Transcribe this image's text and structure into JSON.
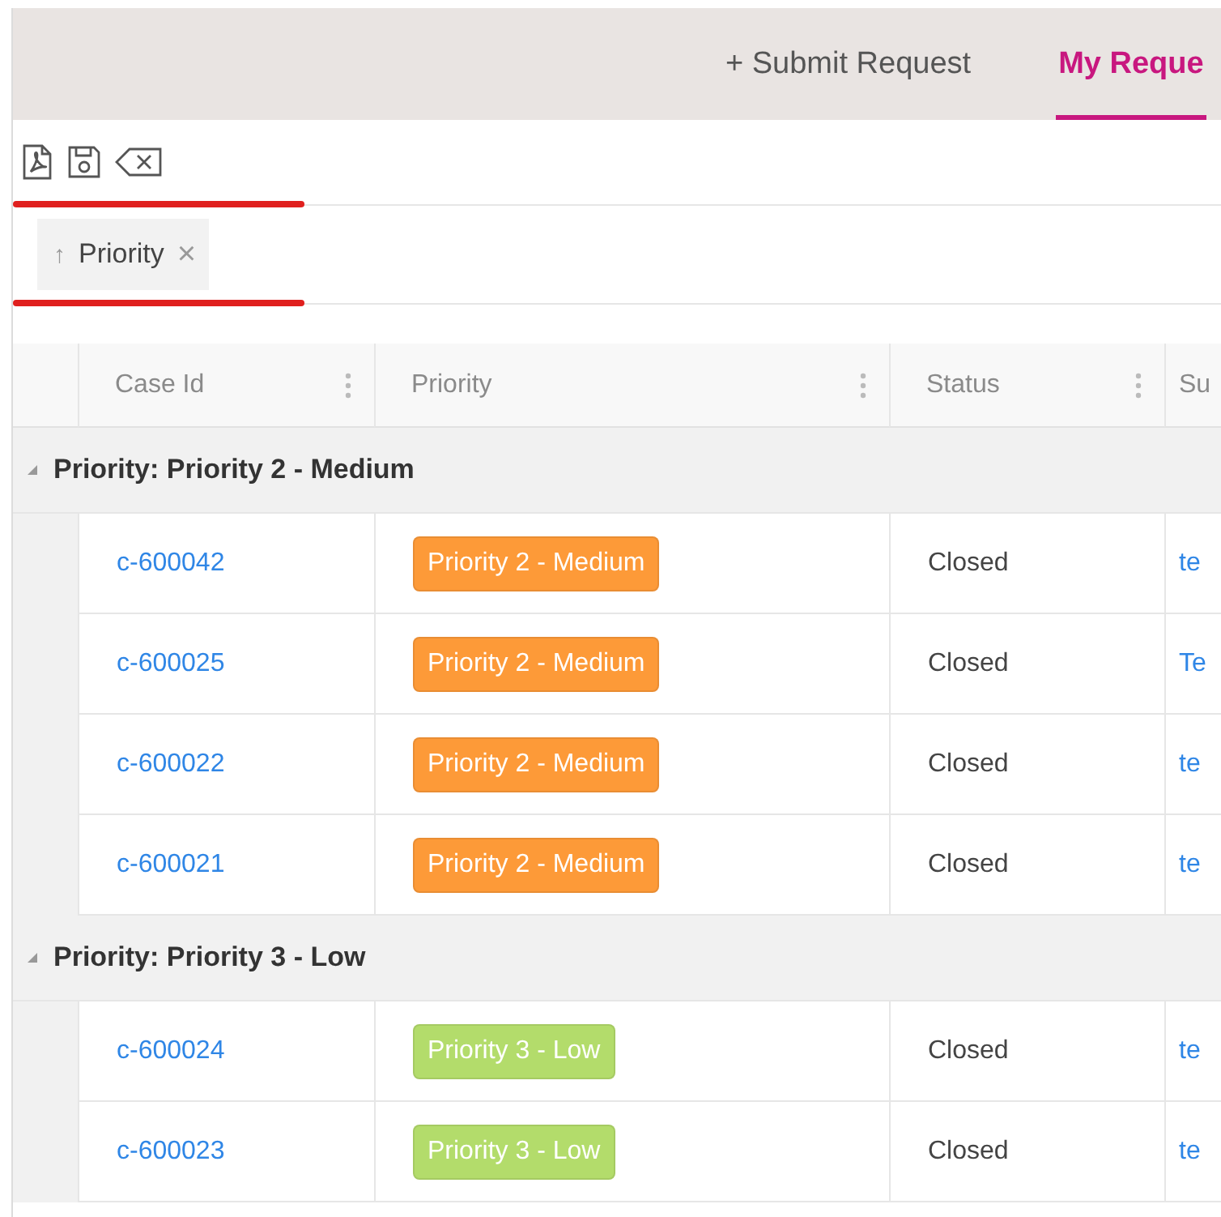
{
  "tabs": [
    {
      "label": "+ Submit Request",
      "selected": false
    },
    {
      "label": "My Reque",
      "selected": true
    }
  ],
  "sort_chips": [
    {
      "arrow": "↑",
      "label": "Priority",
      "remove": "×"
    }
  ],
  "table": {
    "columns": [
      {
        "label": "Case Id",
        "menu": true
      },
      {
        "label": "Priority",
        "menu": true
      },
      {
        "label": "Status",
        "menu": true
      },
      {
        "label": "Su"
      }
    ],
    "groups": [
      {
        "label": "Priority: Priority 2 - Medium",
        "expanded": true,
        "rows": [
          {
            "case_id": "c-600042",
            "priority": {
              "label": "Priority 2 - Medium",
              "color": "#fd9a38"
            },
            "status": "Closed",
            "column_4": "te"
          },
          {
            "case_id": "c-600025",
            "priority": {
              "label": "Priority 2 - Medium",
              "color": "#fd9a38"
            },
            "status": "Closed",
            "column_4": "Te"
          },
          {
            "case_id": "c-600022",
            "priority": {
              "label": "Priority 2 - Medium",
              "color": "#fd9a38"
            },
            "status": "Closed",
            "column_4": "te"
          },
          {
            "case_id": "c-600021",
            "priority": {
              "label": "Priority 2 - Medium",
              "color": "#fd9a38"
            },
            "status": "Closed",
            "column_4": "te"
          }
        ]
      },
      {
        "label": "Priority: Priority 3 - Low",
        "expanded": true,
        "rows": [
          {
            "case_id": "c-600024",
            "priority": {
              "label": "Priority 3 - Low",
              "color": "#b3dc6b"
            },
            "status": "Closed",
            "column_4": "te"
          },
          {
            "case_id": "c-600023",
            "priority": {
              "label": "Priority 3 - Low",
              "color": "#b3dc6b"
            },
            "status": "Closed",
            "column_4": "te"
          }
        ]
      }
    ]
  }
}
